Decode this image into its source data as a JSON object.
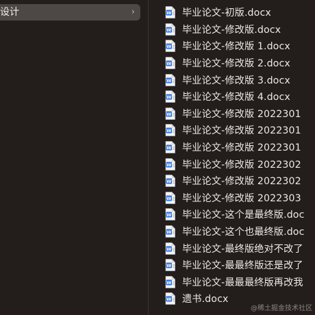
{
  "sidebar": {
    "folder": {
      "label": "设计",
      "chevron_icon": "chevron-right-icon"
    }
  },
  "files": {
    "icon": "word-document-icon",
    "items": [
      {
        "name": "毕业论文-初版.docx"
      },
      {
        "name": "毕业论文-修改版.docx"
      },
      {
        "name": "毕业论文-修改版 1.docx"
      },
      {
        "name": "毕业论文-修改版 2.docx"
      },
      {
        "name": "毕业论文-修改版 3.docx"
      },
      {
        "name": "毕业论文-修改版 4.docx"
      },
      {
        "name": "毕业论文-修改版 2022301"
      },
      {
        "name": "毕业论文-修改版 2022301"
      },
      {
        "name": "毕业论文-修改版 2022301"
      },
      {
        "name": "毕业论文-修改版 2022302"
      },
      {
        "name": "毕业论文-修改版 2022302"
      },
      {
        "name": "毕业论文-修改版 2022303"
      },
      {
        "name": "毕业论文-这个是最终版.doc"
      },
      {
        "name": "毕业论文-这个也最终版.doc"
      },
      {
        "name": "毕业论文-最终版绝对不改了"
      },
      {
        "name": "毕业论文-最最终版还是改了"
      },
      {
        "name": "毕业论文-最最最终版再改我"
      },
      {
        "name": "遗书.docx"
      }
    ]
  },
  "watermark": {
    "text": "@稀土掘金技术社区"
  },
  "colors": {
    "background": "#231d1c",
    "selected_row": "#4c4846",
    "doc_icon_blue": "#2f6fd6"
  }
}
